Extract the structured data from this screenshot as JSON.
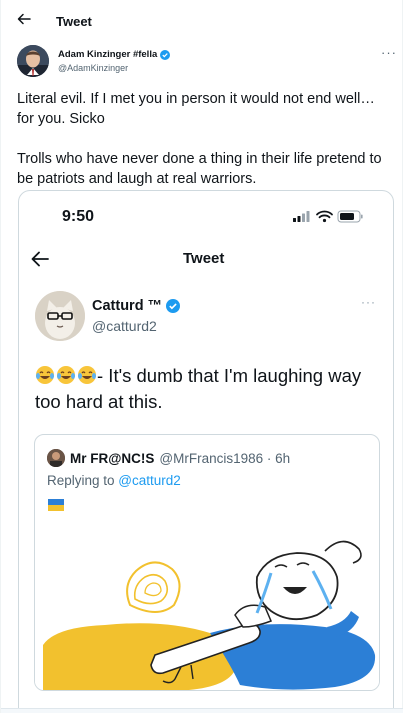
{
  "header": {
    "title": "Tweet"
  },
  "author": {
    "name": "Adam Kinzinger #fella",
    "handle": "@AdamKinzinger",
    "more": "···"
  },
  "tweet": {
    "para1": "Literal evil.  If I met you in person it would not end well… for you.  Sicko",
    "para2": "Trolls who have never done a thing in their life pretend to be patriots and laugh at real warriors."
  },
  "screenshot": {
    "time": "9:50",
    "nav_title": "Tweet",
    "author_name": "Catturd ™",
    "author_handle": "@catturd2",
    "more": "···",
    "text": "- It's dumb that I'm laughing way too hard at this.",
    "quote": {
      "name": "Mr FR@NC!S",
      "meta": "@MrFrancis1986 · 6h",
      "replying_prefix": "Replying to ",
      "replying_handle": "@catturd2"
    }
  },
  "colors": {
    "accent": "#1d9bf0",
    "text": "#0f1419",
    "secondary": "#536471",
    "ukraine_blue": "#2c7fd6",
    "ukraine_yellow": "#f2c12e"
  }
}
